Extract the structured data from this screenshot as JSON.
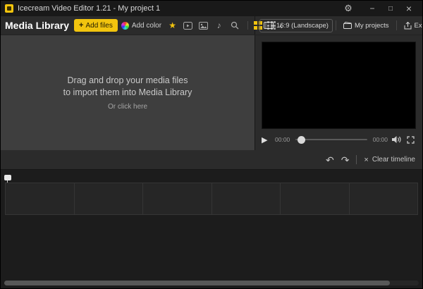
{
  "titlebar": {
    "title": "Icecream Video Editor 1.21 - My project 1"
  },
  "icons": {
    "gear": "⚙",
    "minimize": "−",
    "maximize": "□",
    "close": "×",
    "plus": "+",
    "star": "★",
    "music": "♪",
    "chevron_left": "‹",
    "undo": "↶",
    "redo": "↷",
    "clear": "×",
    "play": "▶"
  },
  "library": {
    "title": "Media Library",
    "add_files": "Add files",
    "add_color": "Add color",
    "drop_line1": "Drag and drop your media files",
    "drop_line2": "to import them into Media Library",
    "drop_click": "Or click here"
  },
  "preview": {
    "aspect": "16:9 (Landscape)",
    "my_projects": "My projects",
    "export": "Export video",
    "current_time": "00:00",
    "total_time": "00:00"
  },
  "timeline": {
    "clear_label": "Clear timeline"
  },
  "colors": {
    "accent": "#f2c40e"
  }
}
